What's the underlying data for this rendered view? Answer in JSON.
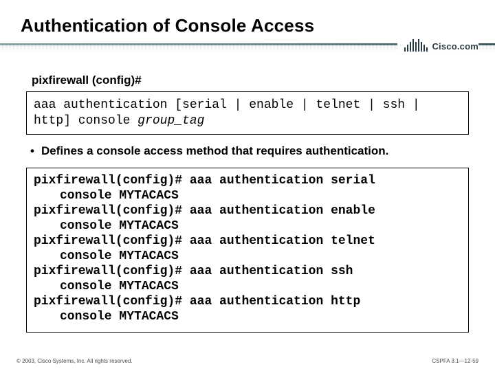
{
  "title": "Authentication of Console Access",
  "brand": "Cisco.com",
  "prompt_label": "pixfirewall (config)#",
  "syntax": {
    "cmd": "aaa authentication [serial | enable | telnet | ssh | http] console ",
    "arg": "group_tag"
  },
  "bullet": "Defines a console access method that requires authentication.",
  "examples": [
    {
      "p1": "pixfirewall(config)# aaa authentication serial",
      "p2": "console MYTACACS"
    },
    {
      "p1": "pixfirewall(config)# aaa authentication enable",
      "p2": "console MYTACACS"
    },
    {
      "p1": "pixfirewall(config)# aaa authentication telnet",
      "p2": "console MYTACACS"
    },
    {
      "p1": "pixfirewall(config)# aaa authentication ssh",
      "p2": "console MYTACACS"
    },
    {
      "p1": "pixfirewall(config)# aaa authentication http",
      "p2": "console MYTACACS"
    }
  ],
  "footer": {
    "left": "© 2003, Cisco Systems, Inc. All rights reserved.",
    "right": "CSPFA 3.1—12-59"
  }
}
